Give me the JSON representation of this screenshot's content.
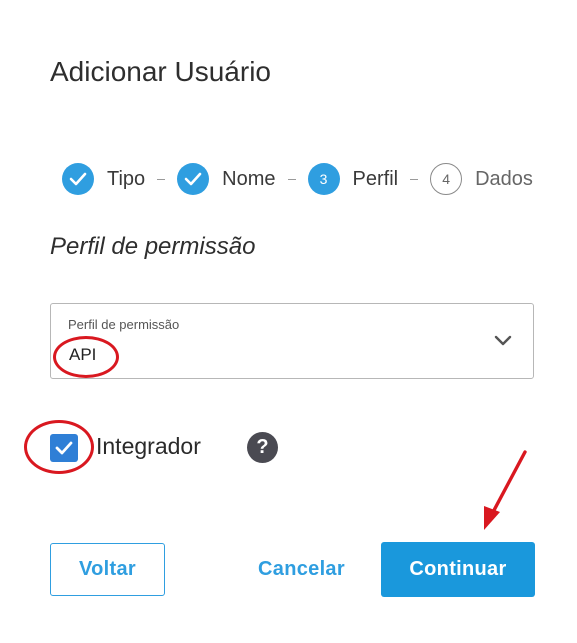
{
  "dialog": {
    "title": "Adicionar Usuário"
  },
  "stepper": {
    "steps": [
      {
        "label": "Tipo",
        "state": "done"
      },
      {
        "label": "Nome",
        "state": "done"
      },
      {
        "label": "Perfil",
        "state": "active",
        "number": "3"
      },
      {
        "label": "Dados",
        "state": "pending",
        "number": "4"
      }
    ]
  },
  "section": {
    "title": "Perfil de permissão"
  },
  "permission_select": {
    "label": "Perfil de permissão",
    "value": "API"
  },
  "integrator": {
    "label": "Integrador",
    "checked": true,
    "help_icon": "question-icon"
  },
  "buttons": {
    "back": "Voltar",
    "cancel": "Cancelar",
    "continue": "Continuar"
  },
  "colors": {
    "accent": "#2f9ee0",
    "checkbox": "#2f7fd6",
    "annotation": "#d91820",
    "help": "#4a4a52"
  }
}
